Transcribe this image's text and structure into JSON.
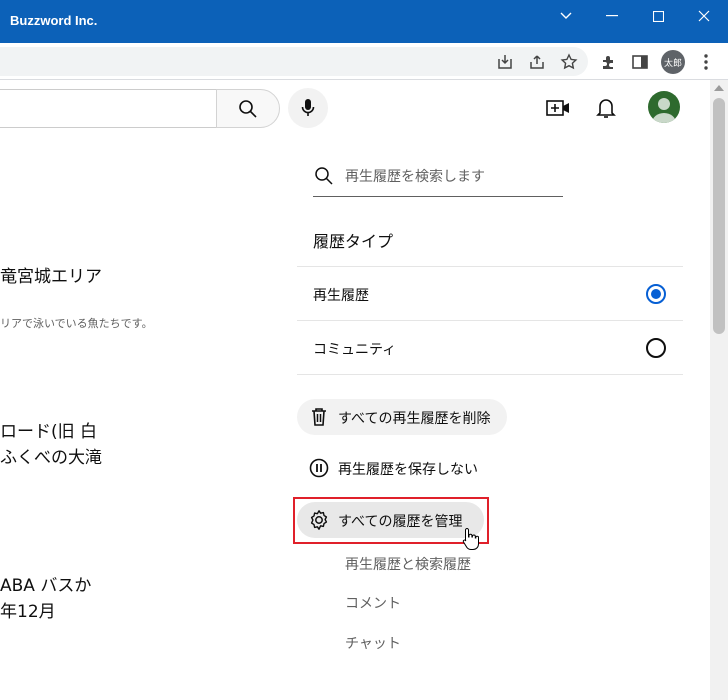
{
  "window": {
    "title": "Buzzword Inc."
  },
  "browser": {
    "profile_label": "太郎"
  },
  "left_content": {
    "video1_title": "竜宮城エリア",
    "video1_desc": "リアで泳いでいる魚たちです。",
    "video2_line1": "ロード(旧 白",
    "video2_line2": "ふくべの大滝",
    "video3_line1": "ABA バスか",
    "video3_line2": "年12月"
  },
  "history_panel": {
    "search_placeholder": "再生履歴を検索します",
    "section_title": "履歴タイプ",
    "types": [
      {
        "label": "再生履歴",
        "selected": true
      },
      {
        "label": "コミュニティ",
        "selected": false
      }
    ],
    "delete_all_label": "すべての再生履歴を削除",
    "pause_label": "再生履歴を保存しない",
    "manage_all_label": "すべての履歴を管理",
    "sub_links": [
      "再生履歴と検索履歴",
      "コメント",
      "チャット"
    ]
  },
  "colors": {
    "titlebar": "#0c61b8",
    "radio_selected": "#065fd4",
    "highlight_border": "#e0202a"
  }
}
